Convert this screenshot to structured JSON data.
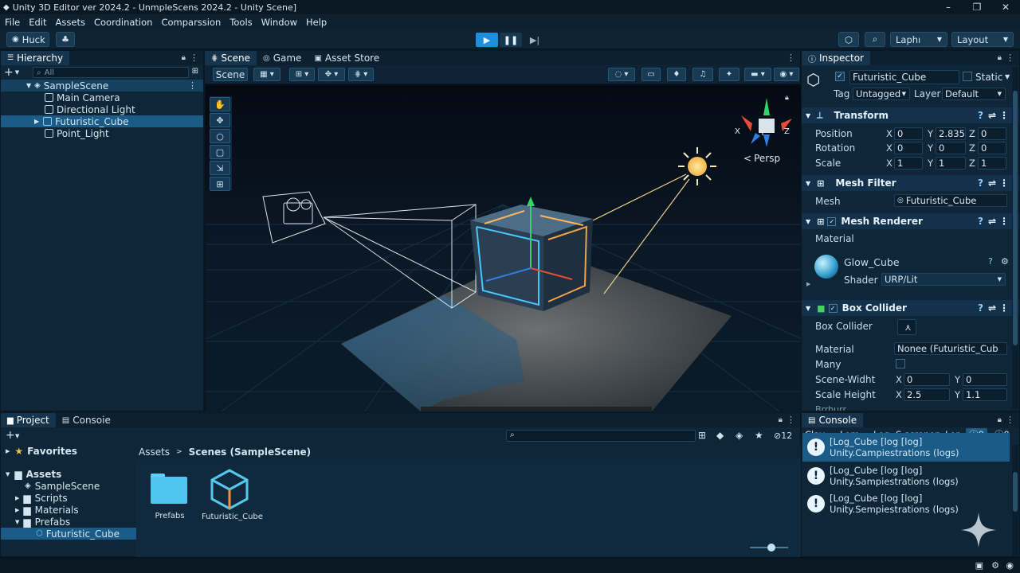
{
  "window": {
    "title": "Unity 3D Editor ver 2024.2 - UnmpleScens 2024.2 - Unity Scene]",
    "min": "–",
    "max": "❐",
    "close": "✕"
  },
  "menu": [
    "File",
    "Edit",
    "Assets",
    "Coordination",
    "Comparssion",
    "Tools",
    "Window",
    "Help"
  ],
  "toolbar": {
    "account": "Huck",
    "layers": "Laphı",
    "layout": "Layout"
  },
  "hierarchy": {
    "title": "Hierarchy",
    "search_placeholder": "All",
    "scene": "SampleScene",
    "items": [
      "Main Camera",
      "Directional Light",
      "Futuristic_Cube",
      "Point_Light"
    ],
    "selected": "Futuristic_Cube"
  },
  "scene_view": {
    "tabs": [
      "Scene",
      "Game",
      "Asset Store"
    ],
    "scene_button": "Scene",
    "projection": "Persp",
    "gizmo_axes": {
      "x": "X",
      "y": "Y",
      "z": "Z"
    }
  },
  "inspector": {
    "title": "Inspector",
    "object_name": "Futuristic_Cube",
    "static_label": "Static",
    "tag_label": "Tag",
    "tag_value": "Untagged",
    "layer_label": "Layer",
    "layer_value": "Default",
    "transform": {
      "title": "Transform",
      "position_label": "Position",
      "rotation_label": "Rotation",
      "scale_label": "Scale",
      "position": {
        "x": "0",
        "y": "2.835",
        "z": "0"
      },
      "rotation": {
        "x": "0",
        "y": "0",
        "z": "0"
      },
      "scale": {
        "x": "1",
        "y": "1",
        "z": "1"
      }
    },
    "mesh_filter": {
      "title": "Mesh Filter",
      "mesh_label": "Mesh",
      "mesh_value": "Futuristic_Cube"
    },
    "mesh_renderer": {
      "title": "Mesh Renderer",
      "material_label": "Material",
      "material_name": "Glow_Cube",
      "shader_label": "Shader",
      "shader_value": "URP/Lit"
    },
    "box_collider": {
      "title": "Box Collider",
      "collider_label": "Box Collider",
      "material_label": "Material",
      "material_value": "Nonee (Futuristic_Cub",
      "many_label": "Many",
      "scene_width_label": "Scene-Widht",
      "scene_width": {
        "x": "0",
        "y": "0"
      },
      "scale_height_label": "Scale Height",
      "scale_height": {
        "x": "2.5",
        "y": "1.1"
      },
      "partial_label": "Brrhurr"
    },
    "axis_labels": {
      "x": "X",
      "y": "Y",
      "z": "Z"
    }
  },
  "project": {
    "tabs": [
      "Project",
      "Consoie"
    ],
    "favorites": "Favorites",
    "assets_root": "Assets",
    "tree": [
      "SampleScene",
      "Scripts",
      "Materials",
      "Prefabs",
      "Futuristic_Cube"
    ],
    "breadcrumb": [
      "Assets",
      "Scenes (SampleScene)"
    ],
    "count": "12",
    "files": [
      {
        "name": "Prefabs",
        "icon": "folder-icon"
      },
      {
        "name": "Futuristic_Cube",
        "icon": "prefab-cube-icon"
      }
    ]
  },
  "console": {
    "title": "Console",
    "clear": "Clav",
    "collapse": "Lom",
    "filter": "Log :S screnen",
    "error_pause": "Lor",
    "info_count": "0",
    "warn_count": "0",
    "logs": [
      {
        "line1": "[Log_Cube [log [log]",
        "line2": "Unity.Campiestrations (logs)"
      },
      {
        "line1": "[Log_Cube [log [log]",
        "line2": "Unity.Sampiestrations (logs)"
      },
      {
        "line1": "[Log_Cube [log [log]",
        "line2": "Unity.Sempiestrations (logs)"
      }
    ]
  },
  "colors": {
    "accent": "#1d8fd8",
    "selection": "#1b5a86",
    "panel": "#0f2638",
    "background": "#0b1d2b"
  }
}
